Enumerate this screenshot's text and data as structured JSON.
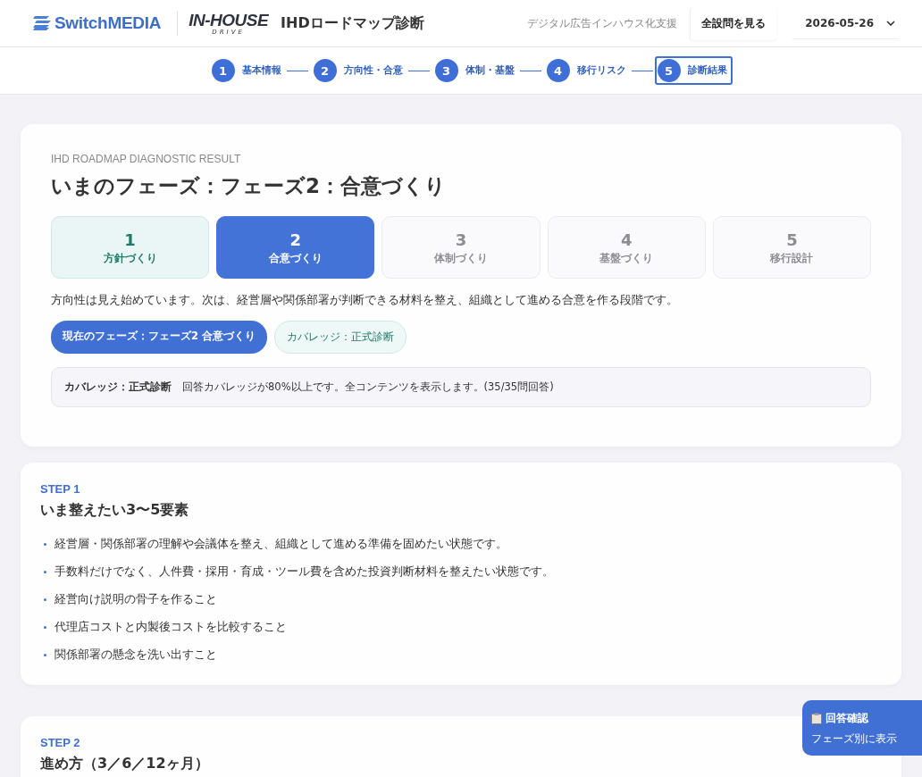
{
  "header": {
    "brand": "SwitchMEDIA",
    "sub_brand": {
      "title": "IN-HOUSE",
      "tagline": "DRIVE"
    },
    "title": "IHDロードマップ診断",
    "tagline": "デジタル広告インハウス化支援",
    "all_questions_button": "全設問を見る",
    "date_select": {
      "value": "2026-05-26"
    }
  },
  "stepper": [
    {
      "number": "1",
      "label": "基本情報",
      "selected": false
    },
    {
      "number": "2",
      "label": "方向性・合意",
      "selected": false
    },
    {
      "number": "3",
      "label": "体制・基盤",
      "selected": false
    },
    {
      "number": "4",
      "label": "移行リスク",
      "selected": false
    },
    {
      "number": "5",
      "label": "診断結果",
      "selected": true
    }
  ],
  "result": {
    "eyebrow": "IHD ROADMAP DIAGNOSTIC RESULT",
    "heading": "いまのフェーズ：フェーズ2：合意づくり",
    "phases": [
      {
        "number": "1",
        "label": "方針づくり",
        "kind": "past"
      },
      {
        "number": "2",
        "label": "合意づくり",
        "kind": "current"
      },
      {
        "number": "3",
        "label": "体制づくり",
        "kind": "future"
      },
      {
        "number": "4",
        "label": "基盤づくり",
        "kind": "future"
      },
      {
        "number": "5",
        "label": "移行設計",
        "kind": "future"
      }
    ],
    "description": "方向性は見え始めています。次は、経営層や関係部署が判断できる材料を整え、組織として進める合意を作る段階です。",
    "badges": [
      {
        "label": "現在のフェーズ：フェーズ2 合意づくり",
        "kind": "primary"
      },
      {
        "label": "カバレッジ：正式診断",
        "kind": "outline"
      }
    ],
    "coverage_note": {
      "label": "カバレッジ：正式診断",
      "text": "回答カバレッジが80%以上です。全コンテンツを表示します。(35/35問回答)"
    }
  },
  "steps": [
    {
      "step": "STEP 1",
      "title": "いま整えたい3〜5要素",
      "items": [
        "経営層・関係部署の理解や会議体を整え、組織として進める準備を固めたい状態です。",
        "手数料だけでなく、人件費・採用・育成・ツール費を含めた投資判断材料を整えたい状態です。",
        "経営向け説明の骨子を作ること",
        "代理店コストと内製後コストを比較すること",
        "関係部署の懸念を洗い出すこと"
      ]
    },
    {
      "step": "STEP 2",
      "title": "進め方（3／6／12ヶ月）"
    }
  ],
  "floating_button": {
    "title": "回答確認",
    "subtitle": "フェーズ別に表示"
  }
}
